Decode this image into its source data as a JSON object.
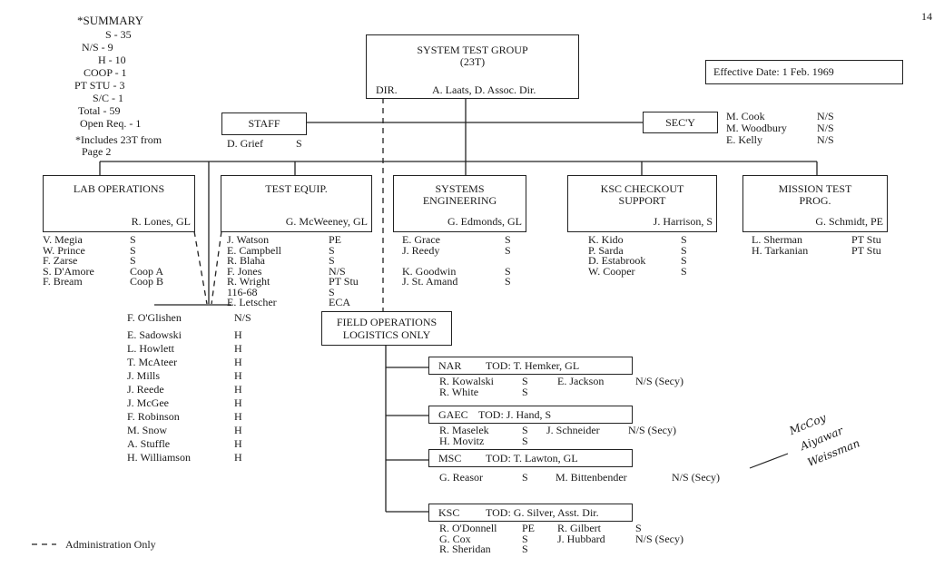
{
  "page_number": "14",
  "summary": {
    "title": "*SUMMARY",
    "lines": [
      "S - 35",
      "N/S - 9",
      "H - 10",
      "COOP - 1",
      "PT STU - 3",
      "S/C - 1",
      "Total - 59",
      "Open Req. - 1"
    ],
    "note_1": "*Includes 23T from",
    "note_2": "Page 2"
  },
  "effective_date": "Effective Date:  1 Feb. 1969",
  "top": {
    "title": "SYSTEM TEST GROUP",
    "code": "(23T)",
    "dir_label": "DIR.",
    "dir_name": "A. Laats, D. Assoc. Dir."
  },
  "staff": {
    "label": "STAFF",
    "members": [
      [
        "D. Grief",
        "S"
      ]
    ]
  },
  "secy": {
    "label": "SEC'Y",
    "members": [
      [
        "M. Cook",
        "N/S"
      ],
      [
        "M. Woodbury",
        "N/S"
      ],
      [
        "E. Kelly",
        "N/S"
      ]
    ]
  },
  "groups": [
    {
      "title": "LAB OPERATIONS",
      "lead": "R. Lones, GL",
      "members": [
        [
          "V. Megia",
          "S"
        ],
        [
          "W. Prince",
          "S"
        ],
        [
          "F. Zarse",
          "S"
        ],
        [
          "S. D'Amore",
          "Coop A"
        ],
        [
          "F. Bream",
          "Coop B"
        ]
      ]
    },
    {
      "title": "TEST EQUIP.",
      "lead": "G. McWeeney,  GL",
      "members": [
        [
          "J. Watson",
          "PE"
        ],
        [
          "E. Campbell",
          "S"
        ],
        [
          "R. Blaha",
          "S"
        ],
        [
          "F. Jones",
          "N/S"
        ],
        [
          "R. Wright",
          "PT Stu"
        ],
        [
          "116-68",
          "S"
        ],
        [
          "E. Letscher",
          "ECA"
        ]
      ]
    },
    {
      "title": "SYSTEMS\nENGINEERING",
      "lead": "G. Edmonds,  GL",
      "members": [
        [
          "E. Grace",
          "S"
        ],
        [
          "J. Reedy",
          "S"
        ],
        [
          "",
          ""
        ],
        [
          "K. Goodwin",
          "S"
        ],
        [
          "J. St. Amand",
          "S"
        ]
      ]
    },
    {
      "title": "KSC CHECKOUT\nSUPPORT",
      "lead": "J. Harrison,    S",
      "members": [
        [
          "K. Kido",
          "S"
        ],
        [
          "P. Sarda",
          "S"
        ],
        [
          "D. Estabrook",
          "S"
        ],
        [
          "W. Cooper",
          "S"
        ]
      ]
    },
    {
      "title": "MISSION TEST\nPROG.",
      "lead": "G. Schmidt,    PE",
      "members": [
        [
          "L. Sherman",
          "PT Stu"
        ],
        [
          "H. Tarkanian",
          "PT Stu"
        ]
      ]
    }
  ],
  "hourly": {
    "members": [
      [
        "F. O'Glishen",
        "N/S"
      ],
      [
        "E. Sadowski",
        "H"
      ],
      [
        "L. Howlett",
        "H"
      ],
      [
        "T. McAteer",
        "H"
      ],
      [
        "J. Mills",
        "H"
      ],
      [
        "J. Reede",
        "H"
      ],
      [
        "J. McGee",
        "H"
      ],
      [
        "F. Robinson",
        "H"
      ],
      [
        "M. Snow",
        "H"
      ],
      [
        "A. Stuffle",
        "H"
      ],
      [
        "H. Williamson",
        "H"
      ]
    ]
  },
  "field_ops": {
    "title_1": "FIELD OPERATIONS",
    "title_2": "LOGISTICS ONLY",
    "sites": [
      {
        "code": "NAR",
        "tod": "TOD: T. Hemker, GL",
        "rows": [
          [
            "R. Kowalski",
            "S",
            "E. Jackson",
            "N/S (Secy)"
          ],
          [
            "R. White",
            "S",
            "",
            ""
          ]
        ]
      },
      {
        "code": "GAEC",
        "tod": "TOD:  J. Hand,   S",
        "rows": [
          [
            "R. Maselek",
            "S",
            "J. Schneider",
            "N/S  (Secy)"
          ],
          [
            "H. Movitz",
            "S",
            "",
            ""
          ]
        ]
      },
      {
        "code": "MSC",
        "tod": "TOD:  T. Lawton, GL",
        "rows": [
          [
            "G. Reasor",
            "S",
            "M. Bittenbender",
            "N/S  (Secy)"
          ]
        ]
      },
      {
        "code": "KSC",
        "tod": "TOD: G. Silver, Asst. Dir.",
        "rows": [
          [
            "R. O'Donnell",
            "PE",
            "R. Gilbert",
            "S"
          ],
          [
            "G. Cox",
            "S",
            "J. Hubbard",
            "N/S (Secy)"
          ],
          [
            "R. Sheridan",
            "S",
            "",
            ""
          ]
        ]
      }
    ]
  },
  "legend": {
    "symbol": "- - - -",
    "label": "Administration Only"
  },
  "handwritten": [
    "McCoy",
    "Aiyawar",
    "Weissman"
  ]
}
